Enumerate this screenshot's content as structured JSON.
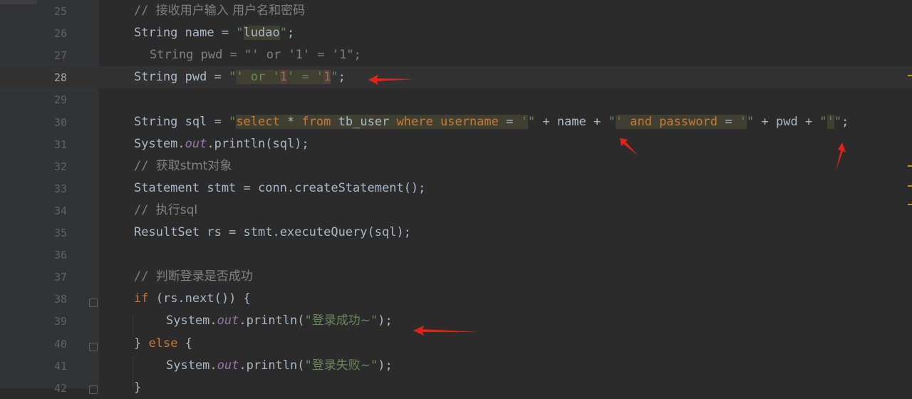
{
  "editor": {
    "lines": [
      {
        "n": "25",
        "indent": 0,
        "html": "<span class=\"cmt\">// <span class=\"cjk\">接收用户输入 用户名和密码</span></span>"
      },
      {
        "n": "26",
        "indent": 0,
        "html": "String name = <span class=\"str\">\"<span class=\"inj sqlid\">ludao</span>\"</span>;"
      },
      {
        "n": "27",
        "indent": 1,
        "html": "<span class=\"cmt\">String pwd = \"' or '1' = '1\";</span>"
      },
      {
        "n": "28",
        "indent": 0,
        "current": true,
        "html": "String pwd = <span class=\"str\">\"<span class=\"inj\">' or '<span class=\"redmark\">1</span>' = '<span class=\"redmark\">1</span></span>\"</span>;"
      },
      {
        "n": "29",
        "indent": 0,
        "html": ""
      },
      {
        "n": "30",
        "indent": 0,
        "html": "String sql = <span class=\"str\">\"</span><span class=\"inj\"><span class=\"kw\">select</span> * <span class=\"kw\">from</span> <span class=\"sqlid\">tb_user</span> <span class=\"kw\">where</span> <span class=\"kw\">username</span> = <span class=\"str\">'</span></span><span class=\"str\">\"</span> + name + <span class=\"str\">\"</span><span class=\"inj\"><span class=\"str\">'</span> <span class=\"kw\">and</span> <span class=\"kw\">password</span> = <span class=\"str\">'</span></span><span class=\"str\">\"</span> + pwd + <span class=\"str\">\"</span><span class=\"inj\"><span class=\"str\">'</span></span><span class=\"str\">\"</span>;"
      },
      {
        "n": "31",
        "indent": 0,
        "html": "System.<span class=\"fld\">out</span>.println(sql);"
      },
      {
        "n": "32",
        "indent": 0,
        "html": "<span class=\"cmt\">// <span class=\"cjk\">获取stmt对象</span></span>"
      },
      {
        "n": "33",
        "indent": 0,
        "html": "Statement stmt = conn.createStatement();"
      },
      {
        "n": "34",
        "indent": 0,
        "html": "<span class=\"cmt\">// <span class=\"cjk\">执行sql</span></span>"
      },
      {
        "n": "35",
        "indent": 0,
        "html": "ResultSet rs = stmt.executeQuery(sql);"
      },
      {
        "n": "36",
        "indent": 0,
        "html": ""
      },
      {
        "n": "37",
        "indent": 0,
        "html": "<span class=\"cmt\">// <span class=\"cjk\">判断登录是否成功</span></span>"
      },
      {
        "n": "38",
        "indent": 0,
        "html": "<span class=\"kw\">if</span> (rs.next()) {"
      },
      {
        "n": "39",
        "indent": 2,
        "html": "System.<span class=\"fld\">out</span>.println(<span class=\"str\">\"<span class=\"cjk\">登录成功~</span>\"</span>);"
      },
      {
        "n": "40",
        "indent": 0,
        "html": "} <span class=\"kw\">else</span> {"
      },
      {
        "n": "41",
        "indent": 2,
        "html": "System.<span class=\"fld\">out</span>.println(<span class=\"str\">\"<span class=\"cjk\">登录失败~</span>\"</span>);"
      },
      {
        "n": "42",
        "indent": 0,
        "html": "}"
      }
    ]
  },
  "colors": {
    "background": "#2b2b2b",
    "gutter": "#313335",
    "keyword": "#cc7832",
    "string": "#6a8759",
    "comment": "#808080",
    "field": "#9876aa",
    "text": "#a9b7c6",
    "annotation_arrow": "#e2231a"
  },
  "icons": [
    "fold-open-icon",
    "fold-close-icon",
    "red-arrow-annotation"
  ]
}
